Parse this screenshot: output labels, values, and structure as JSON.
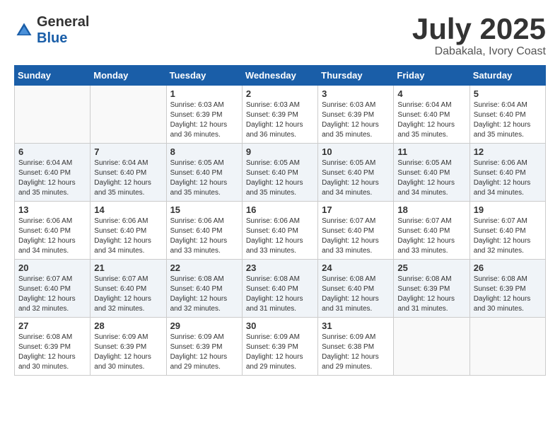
{
  "logo": {
    "general": "General",
    "blue": "Blue"
  },
  "title": {
    "month_year": "July 2025",
    "location": "Dabakala, Ivory Coast"
  },
  "weekdays": [
    "Sunday",
    "Monday",
    "Tuesday",
    "Wednesday",
    "Thursday",
    "Friday",
    "Saturday"
  ],
  "weeks": [
    [
      {
        "day": "",
        "sunrise": "",
        "sunset": "",
        "daylight": ""
      },
      {
        "day": "",
        "sunrise": "",
        "sunset": "",
        "daylight": ""
      },
      {
        "day": "1",
        "sunrise": "Sunrise: 6:03 AM",
        "sunset": "Sunset: 6:39 PM",
        "daylight": "Daylight: 12 hours and 36 minutes."
      },
      {
        "day": "2",
        "sunrise": "Sunrise: 6:03 AM",
        "sunset": "Sunset: 6:39 PM",
        "daylight": "Daylight: 12 hours and 36 minutes."
      },
      {
        "day": "3",
        "sunrise": "Sunrise: 6:03 AM",
        "sunset": "Sunset: 6:39 PM",
        "daylight": "Daylight: 12 hours and 35 minutes."
      },
      {
        "day": "4",
        "sunrise": "Sunrise: 6:04 AM",
        "sunset": "Sunset: 6:40 PM",
        "daylight": "Daylight: 12 hours and 35 minutes."
      },
      {
        "day": "5",
        "sunrise": "Sunrise: 6:04 AM",
        "sunset": "Sunset: 6:40 PM",
        "daylight": "Daylight: 12 hours and 35 minutes."
      }
    ],
    [
      {
        "day": "6",
        "sunrise": "Sunrise: 6:04 AM",
        "sunset": "Sunset: 6:40 PM",
        "daylight": "Daylight: 12 hours and 35 minutes."
      },
      {
        "day": "7",
        "sunrise": "Sunrise: 6:04 AM",
        "sunset": "Sunset: 6:40 PM",
        "daylight": "Daylight: 12 hours and 35 minutes."
      },
      {
        "day": "8",
        "sunrise": "Sunrise: 6:05 AM",
        "sunset": "Sunset: 6:40 PM",
        "daylight": "Daylight: 12 hours and 35 minutes."
      },
      {
        "day": "9",
        "sunrise": "Sunrise: 6:05 AM",
        "sunset": "Sunset: 6:40 PM",
        "daylight": "Daylight: 12 hours and 35 minutes."
      },
      {
        "day": "10",
        "sunrise": "Sunrise: 6:05 AM",
        "sunset": "Sunset: 6:40 PM",
        "daylight": "Daylight: 12 hours and 34 minutes."
      },
      {
        "day": "11",
        "sunrise": "Sunrise: 6:05 AM",
        "sunset": "Sunset: 6:40 PM",
        "daylight": "Daylight: 12 hours and 34 minutes."
      },
      {
        "day": "12",
        "sunrise": "Sunrise: 6:06 AM",
        "sunset": "Sunset: 6:40 PM",
        "daylight": "Daylight: 12 hours and 34 minutes."
      }
    ],
    [
      {
        "day": "13",
        "sunrise": "Sunrise: 6:06 AM",
        "sunset": "Sunset: 6:40 PM",
        "daylight": "Daylight: 12 hours and 34 minutes."
      },
      {
        "day": "14",
        "sunrise": "Sunrise: 6:06 AM",
        "sunset": "Sunset: 6:40 PM",
        "daylight": "Daylight: 12 hours and 34 minutes."
      },
      {
        "day": "15",
        "sunrise": "Sunrise: 6:06 AM",
        "sunset": "Sunset: 6:40 PM",
        "daylight": "Daylight: 12 hours and 33 minutes."
      },
      {
        "day": "16",
        "sunrise": "Sunrise: 6:06 AM",
        "sunset": "Sunset: 6:40 PM",
        "daylight": "Daylight: 12 hours and 33 minutes."
      },
      {
        "day": "17",
        "sunrise": "Sunrise: 6:07 AM",
        "sunset": "Sunset: 6:40 PM",
        "daylight": "Daylight: 12 hours and 33 minutes."
      },
      {
        "day": "18",
        "sunrise": "Sunrise: 6:07 AM",
        "sunset": "Sunset: 6:40 PM",
        "daylight": "Daylight: 12 hours and 33 minutes."
      },
      {
        "day": "19",
        "sunrise": "Sunrise: 6:07 AM",
        "sunset": "Sunset: 6:40 PM",
        "daylight": "Daylight: 12 hours and 32 minutes."
      }
    ],
    [
      {
        "day": "20",
        "sunrise": "Sunrise: 6:07 AM",
        "sunset": "Sunset: 6:40 PM",
        "daylight": "Daylight: 12 hours and 32 minutes."
      },
      {
        "day": "21",
        "sunrise": "Sunrise: 6:07 AM",
        "sunset": "Sunset: 6:40 PM",
        "daylight": "Daylight: 12 hours and 32 minutes."
      },
      {
        "day": "22",
        "sunrise": "Sunrise: 6:08 AM",
        "sunset": "Sunset: 6:40 PM",
        "daylight": "Daylight: 12 hours and 32 minutes."
      },
      {
        "day": "23",
        "sunrise": "Sunrise: 6:08 AM",
        "sunset": "Sunset: 6:40 PM",
        "daylight": "Daylight: 12 hours and 31 minutes."
      },
      {
        "day": "24",
        "sunrise": "Sunrise: 6:08 AM",
        "sunset": "Sunset: 6:40 PM",
        "daylight": "Daylight: 12 hours and 31 minutes."
      },
      {
        "day": "25",
        "sunrise": "Sunrise: 6:08 AM",
        "sunset": "Sunset: 6:39 PM",
        "daylight": "Daylight: 12 hours and 31 minutes."
      },
      {
        "day": "26",
        "sunrise": "Sunrise: 6:08 AM",
        "sunset": "Sunset: 6:39 PM",
        "daylight": "Daylight: 12 hours and 30 minutes."
      }
    ],
    [
      {
        "day": "27",
        "sunrise": "Sunrise: 6:08 AM",
        "sunset": "Sunset: 6:39 PM",
        "daylight": "Daylight: 12 hours and 30 minutes."
      },
      {
        "day": "28",
        "sunrise": "Sunrise: 6:09 AM",
        "sunset": "Sunset: 6:39 PM",
        "daylight": "Daylight: 12 hours and 30 minutes."
      },
      {
        "day": "29",
        "sunrise": "Sunrise: 6:09 AM",
        "sunset": "Sunset: 6:39 PM",
        "daylight": "Daylight: 12 hours and 29 minutes."
      },
      {
        "day": "30",
        "sunrise": "Sunrise: 6:09 AM",
        "sunset": "Sunset: 6:39 PM",
        "daylight": "Daylight: 12 hours and 29 minutes."
      },
      {
        "day": "31",
        "sunrise": "Sunrise: 6:09 AM",
        "sunset": "Sunset: 6:38 PM",
        "daylight": "Daylight: 12 hours and 29 minutes."
      },
      {
        "day": "",
        "sunrise": "",
        "sunset": "",
        "daylight": ""
      },
      {
        "day": "",
        "sunrise": "",
        "sunset": "",
        "daylight": ""
      }
    ]
  ]
}
